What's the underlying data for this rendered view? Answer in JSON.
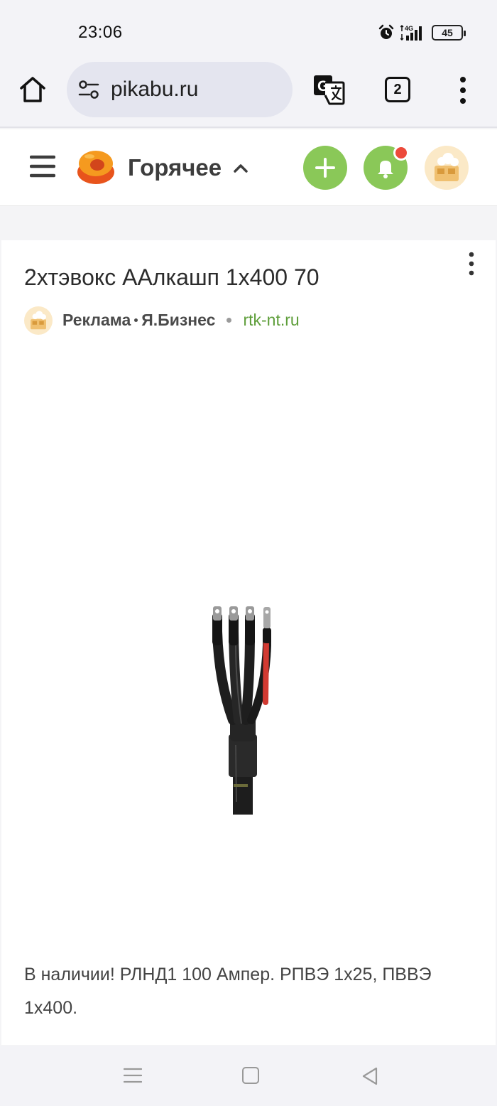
{
  "status_bar": {
    "time": "23:06",
    "network": "4G",
    "battery": "45",
    "icons": [
      "alarm-icon",
      "signal-icon",
      "battery-icon"
    ]
  },
  "browser": {
    "url": "pikabu.ru",
    "tab_count": "2",
    "icons": [
      "home-icon",
      "site-settings-icon",
      "translate-icon",
      "tabs-icon",
      "more-vert-icon"
    ]
  },
  "site_header": {
    "section": "Горячее",
    "icons": [
      "menu-icon",
      "pikabu-logo",
      "chevron-up-icon",
      "plus-icon",
      "bell-icon",
      "avatar"
    ],
    "colors": {
      "green": "#8ac858",
      "notification": "#ec4a3a"
    }
  },
  "ad": {
    "title": "2хтэвокс ААлкашп 1х400 70",
    "label": "Реклама",
    "advertiser": "Я.Бизнес",
    "domain": "rtk-nt.ru",
    "description": "В наличии! РЛНД1 100 Ампер. РПВЭ 1х25, ПВВЭ 1х400.",
    "image": "cable-termination-kit",
    "colors": {
      "domain": "#5e9e3a"
    }
  },
  "system_nav": {
    "icons": [
      "recents-icon",
      "home-square-icon",
      "back-triangle-icon"
    ]
  }
}
